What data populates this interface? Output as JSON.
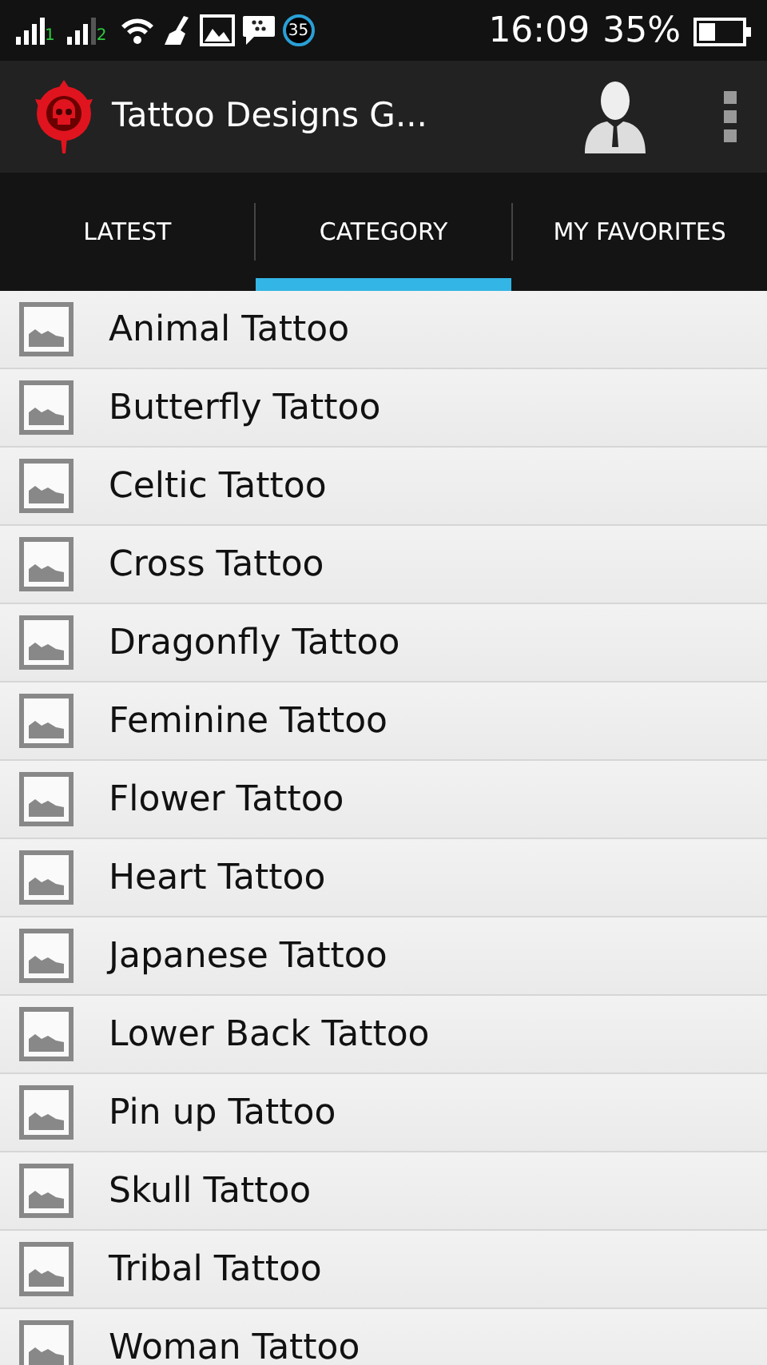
{
  "status_bar": {
    "sim_labels": [
      "1",
      "2"
    ],
    "notification_count": "35",
    "time": "16:09",
    "battery": "35%"
  },
  "app_bar": {
    "title": "Tattoo Designs G..."
  },
  "tabs": [
    {
      "label": "LATEST",
      "selected": false
    },
    {
      "label": "CATEGORY",
      "selected": true
    },
    {
      "label": "MY FAVORITES",
      "selected": false
    }
  ],
  "categories": [
    {
      "label": "Animal Tattoo"
    },
    {
      "label": "Butterfly Tattoo"
    },
    {
      "label": "Celtic Tattoo"
    },
    {
      "label": "Cross Tattoo"
    },
    {
      "label": "Dragonfly Tattoo"
    },
    {
      "label": "Feminine Tattoo"
    },
    {
      "label": "Flower Tattoo"
    },
    {
      "label": "Heart Tattoo"
    },
    {
      "label": "Japanese Tattoo"
    },
    {
      "label": "Lower Back Tattoo"
    },
    {
      "label": "Pin up Tattoo"
    },
    {
      "label": "Skull Tattoo"
    },
    {
      "label": "Tribal Tattoo"
    },
    {
      "label": "Woman Tattoo"
    }
  ]
}
